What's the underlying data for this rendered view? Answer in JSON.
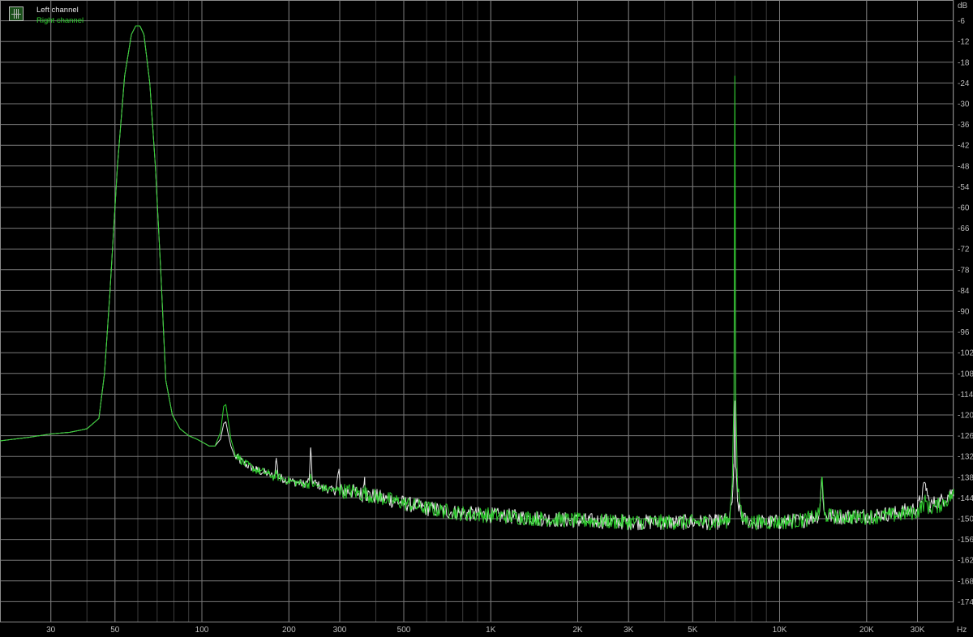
{
  "chart_data": {
    "type": "line",
    "title": "",
    "xlabel": "Hz",
    "ylabel": "dB",
    "x_scale": "log",
    "xlim": [
      20,
      40000
    ],
    "ylim": [
      -180,
      0
    ],
    "grid": true,
    "legend_position": "top-left",
    "x_ticks": [
      {
        "value": 30,
        "label": "30"
      },
      {
        "value": 50,
        "label": "50"
      },
      {
        "value": 100,
        "label": "100"
      },
      {
        "value": 200,
        "label": "200"
      },
      {
        "value": 300,
        "label": "300"
      },
      {
        "value": 500,
        "label": "500"
      },
      {
        "value": 1000,
        "label": "1K"
      },
      {
        "value": 2000,
        "label": "2K"
      },
      {
        "value": 3000,
        "label": "3K"
      },
      {
        "value": 5000,
        "label": "5K"
      },
      {
        "value": 10000,
        "label": "10K"
      },
      {
        "value": 20000,
        "label": "20K"
      },
      {
        "value": 30000,
        "label": "30K"
      }
    ],
    "y_ticks": [
      -6,
      -12,
      -18,
      -24,
      -30,
      -36,
      -42,
      -48,
      -54,
      -60,
      -66,
      -72,
      -78,
      -84,
      -90,
      -96,
      -102,
      -108,
      -114,
      -120,
      -126,
      -132,
      -138,
      -144,
      -150,
      -156,
      -162,
      -168,
      -174
    ],
    "series": [
      {
        "name": "Left channel",
        "color": "#e8e8e8",
        "points": [
          [
            20,
            -127.5
          ],
          [
            25,
            -126.5
          ],
          [
            30,
            -125.5
          ],
          [
            35,
            -125
          ],
          [
            40,
            -124
          ],
          [
            44,
            -121
          ],
          [
            46,
            -108
          ],
          [
            48,
            -85
          ],
          [
            51,
            -48
          ],
          [
            54,
            -22
          ],
          [
            57,
            -10
          ],
          [
            59,
            -7.5
          ],
          [
            61,
            -7.5
          ],
          [
            63,
            -10
          ],
          [
            66,
            -24
          ],
          [
            69,
            -48
          ],
          [
            72,
            -78
          ],
          [
            75,
            -110
          ],
          [
            79,
            -120
          ],
          [
            84,
            -124
          ],
          [
            90,
            -126
          ],
          [
            96,
            -127
          ],
          [
            101,
            -128
          ],
          [
            106,
            -129
          ],
          [
            111,
            -129
          ],
          [
            116,
            -127
          ],
          [
            119,
            -122.5
          ],
          [
            121,
            -122
          ],
          [
            123,
            -125
          ],
          [
            126,
            -129
          ],
          [
            130,
            -132
          ],
          [
            140,
            -134
          ],
          [
            155,
            -136
          ],
          [
            170,
            -137
          ],
          [
            178,
            -138
          ],
          [
            181,
            -132.5
          ],
          [
            184,
            -138
          ],
          [
            200,
            -139
          ],
          [
            225,
            -140
          ],
          [
            235,
            -139
          ],
          [
            238,
            -129.5
          ],
          [
            241,
            -139
          ],
          [
            260,
            -141
          ],
          [
            290,
            -142
          ],
          [
            298,
            -136
          ],
          [
            302,
            -142
          ],
          [
            330,
            -142
          ],
          [
            360,
            -143
          ],
          [
            366,
            -138
          ],
          [
            371,
            -143
          ],
          [
            420,
            -144
          ],
          [
            500,
            -145.5
          ],
          [
            600,
            -147
          ],
          [
            800,
            -148.5
          ],
          [
            1000,
            -149
          ],
          [
            1500,
            -150
          ],
          [
            2000,
            -150.5
          ],
          [
            3000,
            -151
          ],
          [
            4000,
            -151
          ],
          [
            5000,
            -151
          ],
          [
            6000,
            -151
          ],
          [
            6700,
            -150.5
          ],
          [
            6850,
            -145
          ],
          [
            6950,
            -135
          ],
          [
            7000,
            -116
          ],
          [
            7050,
            -135
          ],
          [
            7150,
            -145
          ],
          [
            7400,
            -150
          ],
          [
            8000,
            -151
          ],
          [
            10000,
            -151
          ],
          [
            12000,
            -150.5
          ],
          [
            13700,
            -149
          ],
          [
            14000,
            -138
          ],
          [
            14300,
            -149
          ],
          [
            16000,
            -149.5
          ],
          [
            20000,
            -149
          ],
          [
            25000,
            -148.5
          ],
          [
            30000,
            -147
          ],
          [
            32000,
            -140
          ],
          [
            33000,
            -146
          ],
          [
            36000,
            -145
          ],
          [
            40000,
            -142
          ]
        ]
      },
      {
        "name": "Right channel",
        "color": "#2fd12f",
        "points": [
          [
            20,
            -127.5
          ],
          [
            25,
            -126.5
          ],
          [
            30,
            -125.5
          ],
          [
            35,
            -125
          ],
          [
            40,
            -124
          ],
          [
            44,
            -121
          ],
          [
            46,
            -108
          ],
          [
            48,
            -85
          ],
          [
            51,
            -48
          ],
          [
            54,
            -22
          ],
          [
            57,
            -10
          ],
          [
            59,
            -7.5
          ],
          [
            61,
            -7.5
          ],
          [
            63,
            -10
          ],
          [
            66,
            -24
          ],
          [
            69,
            -48
          ],
          [
            72,
            -78
          ],
          [
            75,
            -110
          ],
          [
            79,
            -120
          ],
          [
            84,
            -124
          ],
          [
            90,
            -126
          ],
          [
            96,
            -127
          ],
          [
            101,
            -128
          ],
          [
            106,
            -129
          ],
          [
            111,
            -129
          ],
          [
            116,
            -125
          ],
          [
            119,
            -117.5
          ],
          [
            121,
            -117
          ],
          [
            123,
            -121
          ],
          [
            126,
            -127
          ],
          [
            130,
            -131
          ],
          [
            140,
            -134
          ],
          [
            155,
            -136
          ],
          [
            170,
            -137
          ],
          [
            178,
            -138
          ],
          [
            181,
            -137
          ],
          [
            184,
            -138
          ],
          [
            200,
            -139
          ],
          [
            225,
            -140
          ],
          [
            235,
            -140
          ],
          [
            238,
            -138
          ],
          [
            241,
            -140
          ],
          [
            260,
            -141
          ],
          [
            290,
            -142
          ],
          [
            298,
            -141
          ],
          [
            302,
            -142
          ],
          [
            330,
            -142
          ],
          [
            360,
            -143
          ],
          [
            366,
            -142
          ],
          [
            371,
            -143
          ],
          [
            420,
            -144
          ],
          [
            500,
            -145.5
          ],
          [
            600,
            -147
          ],
          [
            800,
            -148.5
          ],
          [
            1000,
            -149
          ],
          [
            1500,
            -150
          ],
          [
            2000,
            -150.5
          ],
          [
            3000,
            -151
          ],
          [
            4000,
            -151
          ],
          [
            5000,
            -151
          ],
          [
            6000,
            -151
          ],
          [
            6700,
            -150.5
          ],
          [
            6850,
            -140
          ],
          [
            6950,
            -115
          ],
          [
            7000,
            -22
          ],
          [
            7050,
            -115
          ],
          [
            7150,
            -140
          ],
          [
            7400,
            -150
          ],
          [
            8000,
            -151
          ],
          [
            10000,
            -151
          ],
          [
            12000,
            -150.5
          ],
          [
            13700,
            -149
          ],
          [
            14000,
            -138
          ],
          [
            14300,
            -149
          ],
          [
            16000,
            -149.5
          ],
          [
            20000,
            -149.5
          ],
          [
            25000,
            -149
          ],
          [
            30000,
            -148
          ],
          [
            32000,
            -145
          ],
          [
            33000,
            -147
          ],
          [
            36000,
            -146
          ],
          [
            40000,
            -143
          ]
        ]
      }
    ]
  }
}
